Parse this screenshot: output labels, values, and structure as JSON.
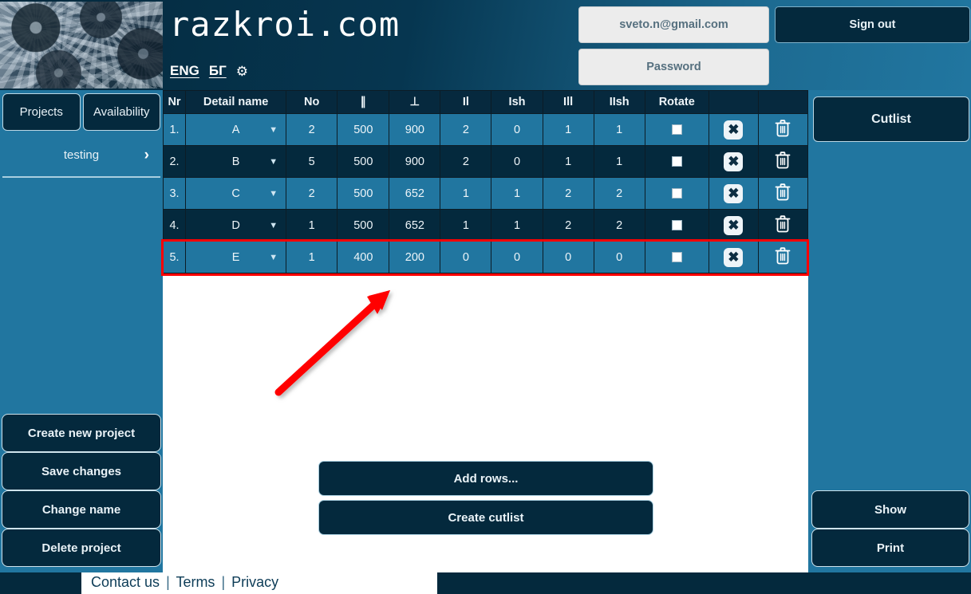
{
  "header": {
    "brand": "razkroi.com",
    "lang_eng": "ENG",
    "lang_bg": "БГ",
    "gear_icon": "gear-icon",
    "email_value": "sveto.n@gmail.com",
    "password_placeholder": "Password",
    "signout_label": "Sign out"
  },
  "sidebar_left": {
    "tabs": [
      {
        "label": "Projects"
      },
      {
        "label": "Availability"
      }
    ],
    "project": {
      "name": "testing",
      "chevron": "›"
    },
    "actions": [
      {
        "label": "Create new project"
      },
      {
        "label": "Save changes"
      },
      {
        "label": "Change name"
      },
      {
        "label": "Delete project"
      }
    ]
  },
  "sidebar_right": {
    "cutlist_label": "Cutlist",
    "actions": [
      {
        "label": "Show"
      },
      {
        "label": "Print"
      }
    ]
  },
  "table": {
    "columns": [
      "Nr",
      "Detail name",
      "No",
      "∥",
      "⊥",
      "Il",
      "Ish",
      "Ill",
      "IIsh",
      "Rotate",
      "",
      ""
    ],
    "rows": [
      {
        "nr": "1.",
        "detail": "A",
        "no": "2",
        "par": "500",
        "perp": "900",
        "il": "2",
        "ish": "0",
        "ill": "1",
        "iish": "1",
        "rotate": false
      },
      {
        "nr": "2.",
        "detail": "B",
        "no": "5",
        "par": "500",
        "perp": "900",
        "il": "2",
        "ish": "0",
        "ill": "1",
        "iish": "1",
        "rotate": false
      },
      {
        "nr": "3.",
        "detail": "C",
        "no": "2",
        "par": "500",
        "perp": "652",
        "il": "1",
        "ish": "1",
        "ill": "2",
        "iish": "2",
        "rotate": false
      },
      {
        "nr": "4.",
        "detail": "D",
        "no": "1",
        "par": "500",
        "perp": "652",
        "il": "1",
        "ish": "1",
        "ill": "2",
        "iish": "2",
        "rotate": false
      },
      {
        "nr": "5.",
        "detail": "E",
        "no": "1",
        "par": "400",
        "perp": "200",
        "il": "0",
        "ish": "0",
        "ill": "0",
        "iish": "0",
        "rotate": false
      }
    ],
    "highlighted_row_index": 4,
    "highlight_color": "#ff0000"
  },
  "main_actions": [
    {
      "label": "Add rows..."
    },
    {
      "label": "Create cutlist"
    }
  ],
  "annotation": {
    "arrow_color": "#ff0000",
    "points_to": "row 5"
  },
  "footer": {
    "contact": "Contact us",
    "terms": "Terms",
    "privacy": "Privacy",
    "separator": "|"
  },
  "colors": {
    "dark_navy": "#04293d",
    "teal": "#2176a0",
    "light_text": "#e9f2f7",
    "field_bg": "#ececec",
    "field_text": "#56707f"
  }
}
